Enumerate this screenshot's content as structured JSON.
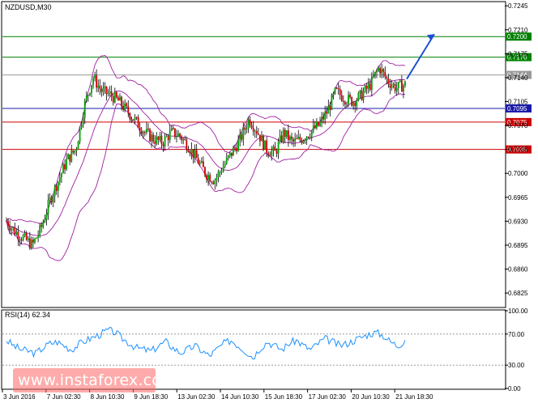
{
  "chart_data": [
    {
      "type": "candlestick",
      "title": "NZDUSD,M30",
      "ylim": [
        0.6805,
        0.725
      ],
      "y_ticks": [
        "0.7245",
        "0.7210",
        "0.7175",
        "0.7140",
        "0.7105",
        "0.7070",
        "0.7035",
        "0.7000",
        "0.6965",
        "0.6930",
        "0.6895",
        "0.6860",
        "0.6825"
      ],
      "x_ticks": [
        "3 Jun 2016",
        "7 Jun 02:30",
        "8 Jun 10:30",
        "9 Jun 18:30",
        "13 Jun 02:30",
        "14 Jun 10:30",
        "15 Jun 18:30",
        "17 Jun 02:30",
        "20 Jun 10:30",
        "21 Jun 18:30"
      ],
      "levels": [
        {
          "label": "0.7200",
          "value": 0.72,
          "color": "#008000"
        },
        {
          "label": "0.7170",
          "value": 0.717,
          "color": "#008000"
        },
        {
          "label": "0.7144",
          "value": 0.7144,
          "color": "#999999"
        },
        {
          "label": "0.7095",
          "value": 0.7095,
          "color": "#1a1aa8"
        },
        {
          "label": "0.7075",
          "value": 0.7075,
          "color": "#cc0000"
        },
        {
          "label": "0.7035",
          "value": 0.7035,
          "color": "#cc0000"
        }
      ],
      "close_path": [
        0.693,
        0.6915,
        0.6905,
        0.6895,
        0.692,
        0.696,
        0.699,
        0.702,
        0.7035,
        0.71,
        0.714,
        0.712,
        0.7115,
        0.7105,
        0.709,
        0.7075,
        0.706,
        0.705,
        0.7045,
        0.706,
        0.7055,
        0.704,
        0.702,
        0.7,
        0.699,
        0.701,
        0.703,
        0.705,
        0.708,
        0.706,
        0.7035,
        0.703,
        0.706,
        0.7045,
        0.705,
        0.706,
        0.707,
        0.709,
        0.712,
        0.711,
        0.7105,
        0.7115,
        0.713,
        0.7155,
        0.7135,
        0.7125,
        0.713
      ],
      "forecast_arrow": {
        "from": 0.7138,
        "to": 0.72,
        "direction": "up",
        "color": "#1a4fd6"
      }
    },
    {
      "type": "line",
      "title": "RSI(14) 62.34",
      "ylim": [
        0,
        100
      ],
      "y_ticks": [
        "100.00",
        "70.00",
        "30.00",
        "0.00"
      ],
      "values": [
        62,
        55,
        50,
        48,
        45,
        52,
        58,
        60,
        55,
        50,
        57,
        62,
        66,
        70,
        75,
        72,
        64,
        58,
        52,
        50,
        48,
        55,
        60,
        52,
        46,
        50,
        55,
        48,
        42,
        50,
        58,
        62,
        55,
        48,
        40,
        52,
        60,
        55,
        50,
        58,
        62,
        55,
        50,
        58,
        64,
        60,
        55,
        58,
        62,
        66,
        70,
        72,
        68,
        60,
        55,
        62
      ]
    }
  ],
  "watermark": "www.instaforex.com"
}
